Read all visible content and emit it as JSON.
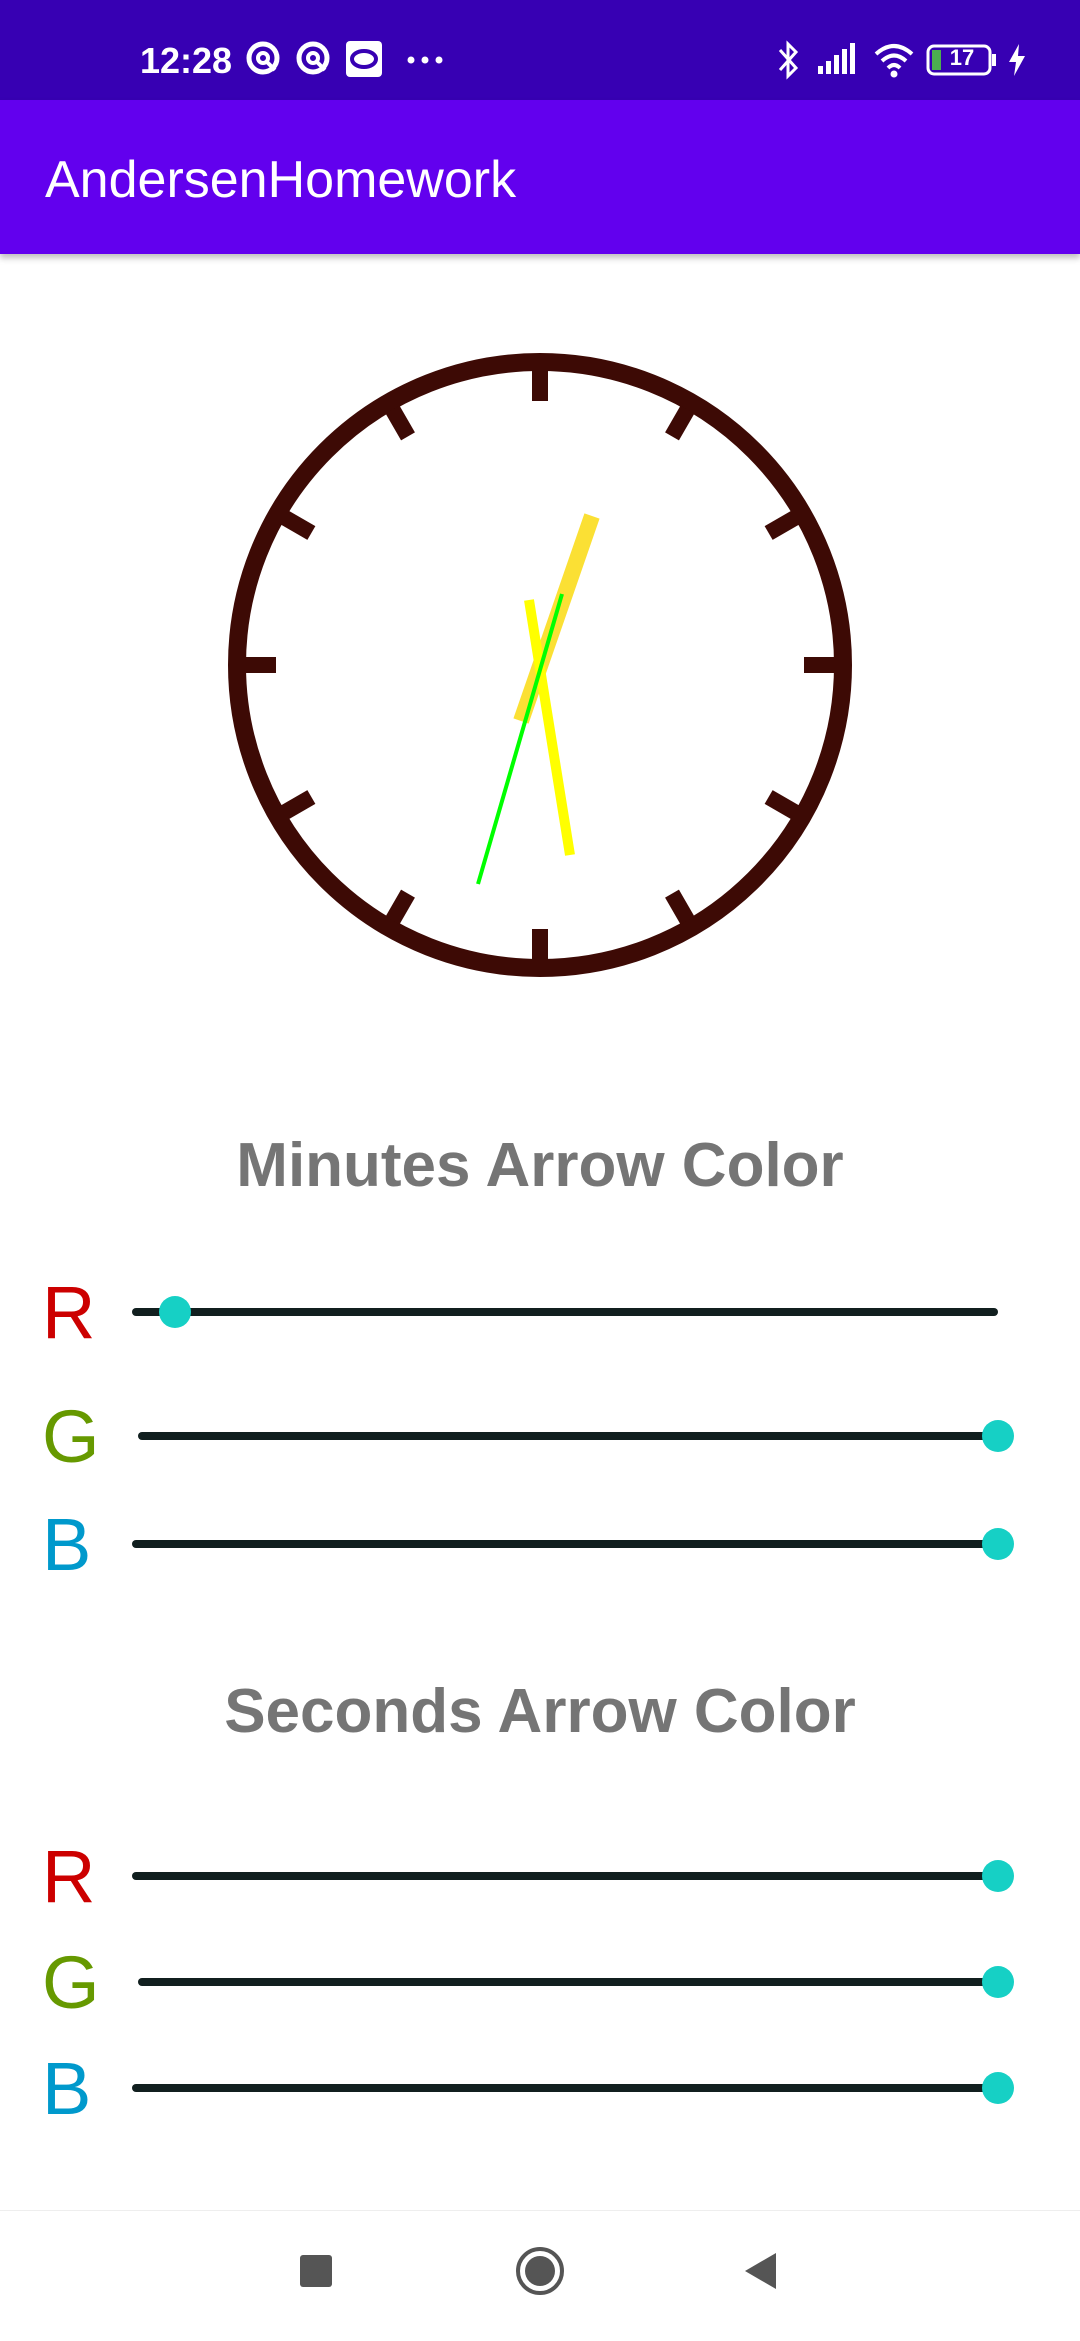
{
  "status_bar": {
    "time": "12:28",
    "battery": "17",
    "left_icons": [
      "sync-icon",
      "sync-icon",
      "screen-record-icon",
      "more-dots-icon"
    ],
    "right_icons": [
      "bluetooth-icon",
      "signal-icon",
      "wifi-icon",
      "battery-icon",
      "charging-icon"
    ]
  },
  "app_bar": {
    "title": "AndersenHomework"
  },
  "clock": {
    "face_color": "#3d0a05",
    "hour_hand_color": "#fbe034",
    "minute_hand_color": "#ffff00",
    "second_hand_color": "#00ff00"
  },
  "minutes_section": {
    "title": "Minutes Arrow Color",
    "sliders": [
      {
        "label": "R",
        "label_color": "#cc0000",
        "value": 0.05
      },
      {
        "label": "G",
        "label_color": "#669900",
        "value": 1.0
      },
      {
        "label": "B",
        "label_color": "#0099cc",
        "value": 1.0
      }
    ]
  },
  "seconds_section": {
    "title": "Seconds Arrow Color",
    "sliders": [
      {
        "label": "R",
        "label_color": "#cc0000",
        "value": 1.0
      },
      {
        "label": "G",
        "label_color": "#669900",
        "value": 1.0
      },
      {
        "label": "B",
        "label_color": "#0099cc",
        "value": 1.0
      }
    ]
  },
  "nav_bar": {
    "icons": [
      "recents-square-icon",
      "home-circle-icon",
      "back-triangle-icon"
    ]
  },
  "colors": {
    "accent": "#16d0c5",
    "status_bar": "#3700b3",
    "app_bar": "#6200ee"
  }
}
